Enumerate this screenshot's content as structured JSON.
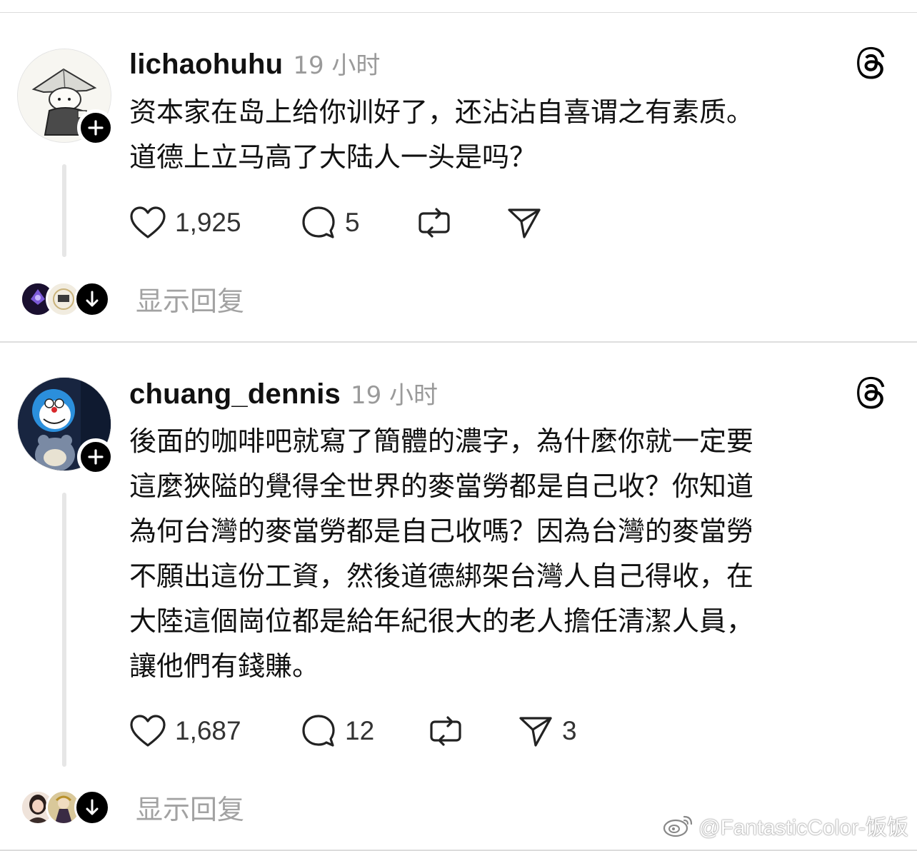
{
  "posts": [
    {
      "username": "lichaohuhu",
      "time": "19 小时",
      "text_lines": [
        "资本家在岛上给你训好了，还沾沾自喜谓之有素质。",
        "道德上立马高了大陆人一头是吗？"
      ],
      "likes": "1,925",
      "comments": "5",
      "reposts": "",
      "shares": "",
      "show_replies": "显示回复",
      "avatar_icon": "straw-hat-monk-avatar"
    },
    {
      "username": "chuang_dennis",
      "time": "19 小时",
      "text_lines": [
        "後面的咖啡吧就寫了簡體的濃字，為什麼你就一定要",
        "這麼狹隘的覺得全世界的麥當勞都是自己收？你知道",
        "為何台灣的麥當勞都是自己收嗎？因為台灣的麥當勞",
        "不願出這份工資，然後道德綁架台灣人自己得收，在",
        "大陸這個崗位都是給年紀很大的老人擔任清潔人員，",
        "讓他們有錢賺。"
      ],
      "likes": "1,687",
      "comments": "12",
      "reposts": "",
      "shares": "3",
      "show_replies": "显示回复",
      "avatar_icon": "doraemon-avatar"
    }
  ],
  "watermark": "@FantasticColor-饭饭",
  "colors": {
    "text": "#111111",
    "muted": "#9a9a9a",
    "thread_line": "#e6e6e6"
  }
}
